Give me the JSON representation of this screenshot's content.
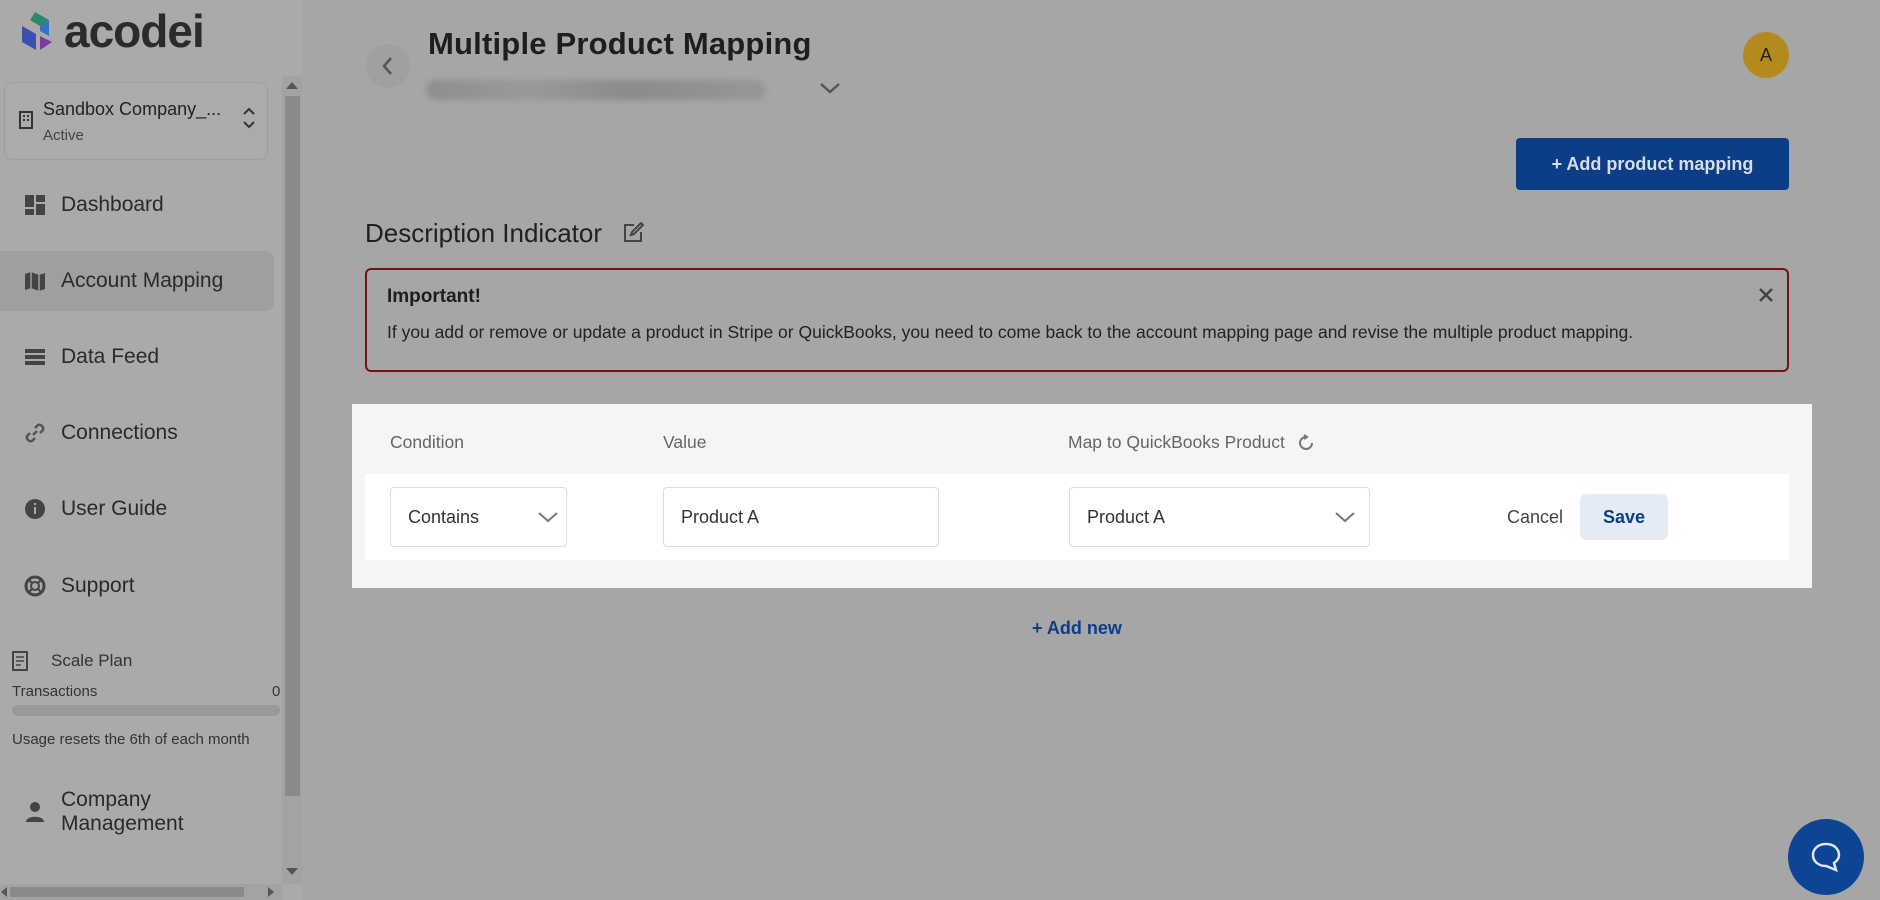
{
  "brand": {
    "name": "acodei"
  },
  "company": {
    "name": "Sandbox Company_...",
    "status": "Active"
  },
  "nav": [
    {
      "label": "Dashboard",
      "icon": "dashboard-icon"
    },
    {
      "label": "Account Mapping",
      "icon": "map-icon"
    },
    {
      "label": "Data Feed",
      "icon": "list-icon"
    },
    {
      "label": "Connections",
      "icon": "link-icon"
    },
    {
      "label": "User Guide",
      "icon": "info-icon"
    },
    {
      "label": "Support",
      "icon": "lifebuoy-icon"
    }
  ],
  "plan": {
    "name": "Scale Plan",
    "transactions_label": "Transactions",
    "transactions_count": "0",
    "usage_fraction": 0.0,
    "reset_note": "Usage resets the 6th of each month"
  },
  "nav_bottom": {
    "label": "Company Management",
    "icon": "person-icon"
  },
  "header": {
    "title": "Multiple Product Mapping",
    "avatar_letter": "A",
    "add_mapping_label": "+ Add product mapping"
  },
  "section": {
    "title": "Description Indicator"
  },
  "alert": {
    "title": "Important!",
    "body": "If you add or remove or update a product in Stripe or QuickBooks, you need to come back to the account mapping page and revise the multiple product mapping."
  },
  "table": {
    "headers": {
      "condition": "Condition",
      "value": "Value",
      "map_to": "Map to QuickBooks Product"
    },
    "row": {
      "condition": "Contains",
      "value": "Product A",
      "product": "Product A"
    },
    "cancel_label": "Cancel",
    "save_label": "Save"
  },
  "add_new_label": "+ Add new",
  "colors": {
    "primary": "#0b3e87",
    "alert_border": "#7a1010",
    "avatar": "#b48a1e"
  }
}
